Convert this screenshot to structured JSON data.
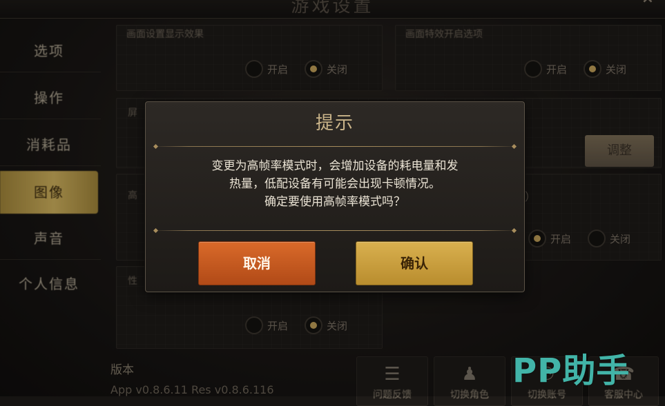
{
  "header": {
    "title": "游戏设置"
  },
  "sidebar": {
    "items": [
      {
        "label": "选项"
      },
      {
        "label": "操作"
      },
      {
        "label": "消耗品"
      },
      {
        "label": "图像",
        "active": true
      },
      {
        "label": "声音"
      },
      {
        "label": "个人信息"
      }
    ]
  },
  "background": {
    "panel_labels": [
      "画面设置显示效果",
      "画面特效开启选项",
      "屏",
      "高",
      "性"
    ],
    "radio_on": "开启",
    "radio_off": "关闭",
    "paren": "）",
    "adjust_label": "调整",
    "version_label": "版本",
    "version_text": "App v0.8.6.11 Res v0.8.6.116",
    "bottom_buttons": [
      "问题反馈",
      "切换角色",
      "切换账号",
      "客服中心"
    ]
  },
  "modal": {
    "title": "提示",
    "message_lines": [
      "变更为高帧率模式时，会增加设备的耗电量和发",
      "热量，低配设备有可能会出现卡顿情况。",
      "确定要使用高帧率模式吗？"
    ],
    "cancel_label": "取消",
    "confirm_label": "确认"
  },
  "watermark": {
    "text": "PP助手"
  },
  "colors": {
    "accent_gold": "#d7b861",
    "cancel_orange": "#c85a20",
    "confirm_gold": "#c99e3e",
    "watermark_teal": "#42b4a8"
  }
}
